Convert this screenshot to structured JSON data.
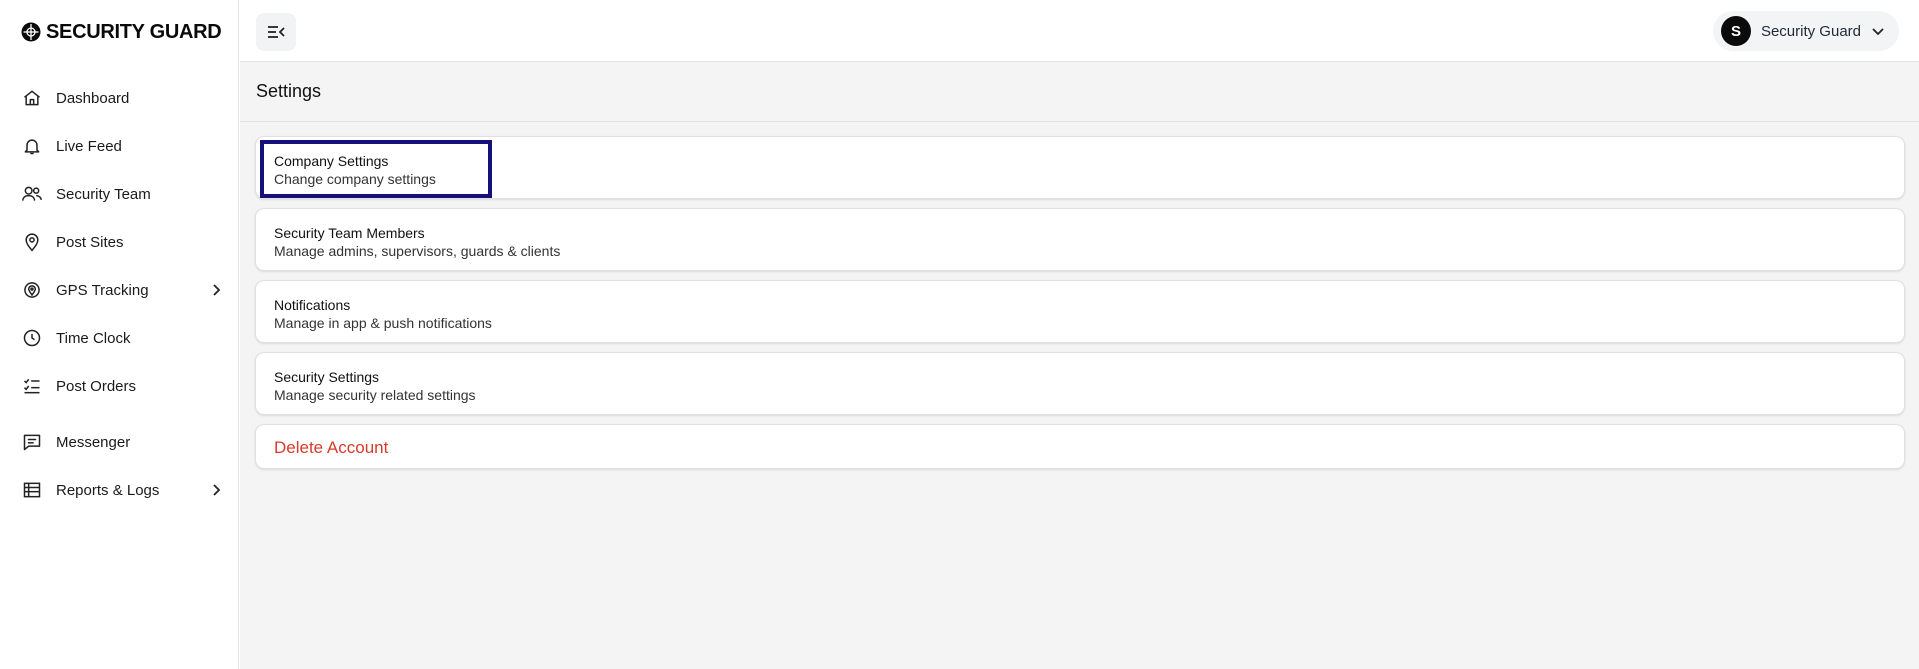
{
  "app": {
    "logo_text": "SECURITY GUARD"
  },
  "sidebar": {
    "items": [
      {
        "label": "Dashboard",
        "icon": "home-icon"
      },
      {
        "label": "Live Feed",
        "icon": "bell-icon"
      },
      {
        "label": "Security Team",
        "icon": "users-icon"
      },
      {
        "label": "Post Sites",
        "icon": "map-pin-icon"
      },
      {
        "label": "GPS Tracking",
        "icon": "gps-icon",
        "has_submenu": true
      },
      {
        "label": "Time Clock",
        "icon": "clock-icon"
      },
      {
        "label": "Post Orders",
        "icon": "checklist-icon"
      },
      {
        "label": "Messenger",
        "icon": "message-icon"
      },
      {
        "label": "Reports & Logs",
        "icon": "table-icon",
        "has_submenu": true
      }
    ]
  },
  "topbar": {
    "user": {
      "initial": "S",
      "name": "Security Guard"
    }
  },
  "page": {
    "title": "Settings"
  },
  "settings": {
    "cards": [
      {
        "title": "Company Settings",
        "subtitle": "Change company settings"
      },
      {
        "title": "Security Team Members",
        "subtitle": "Manage admins, supervisors, guards & clients"
      },
      {
        "title": "Notifications",
        "subtitle": "Manage in app & push notifications"
      },
      {
        "title": "Security Settings",
        "subtitle": "Manage security related settings"
      }
    ],
    "delete_label": "Delete Account"
  },
  "colors": {
    "danger": "#d93a2b",
    "focus": "#15107a"
  }
}
